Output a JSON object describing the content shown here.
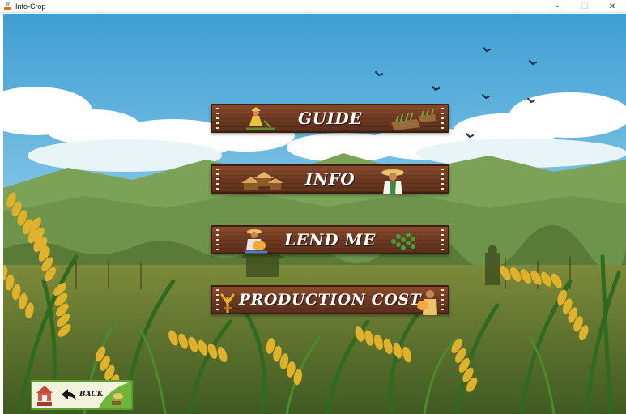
{
  "window": {
    "title": "Info-Crop",
    "controls": {
      "minimize": "–",
      "maximize": "☐",
      "close": "✕"
    }
  },
  "menu": {
    "items": [
      {
        "id": "guide",
        "label": "GUIDE",
        "icon": "farmer-harvesting-icon"
      },
      {
        "id": "info",
        "label": "INFO",
        "icon": "farmer-straw-hat-icon"
      },
      {
        "id": "lend-me",
        "label": "LEND ME",
        "icon": "farmer-with-sack-icon"
      },
      {
        "id": "production-cost",
        "label": "PRODUCTION COST",
        "icon": "farmer-carrying-grain-icon"
      }
    ]
  },
  "back_button": {
    "label": "BACK",
    "icon": "back-arrow-icon"
  },
  "colors": {
    "sky_top": "#3d9ed3",
    "sky_bottom": "#bfe3f1",
    "wood": "#6e3a22",
    "wood_border": "#3c1d10",
    "rice_gold": "#e0b12a",
    "back_border": "#5aa02c"
  }
}
